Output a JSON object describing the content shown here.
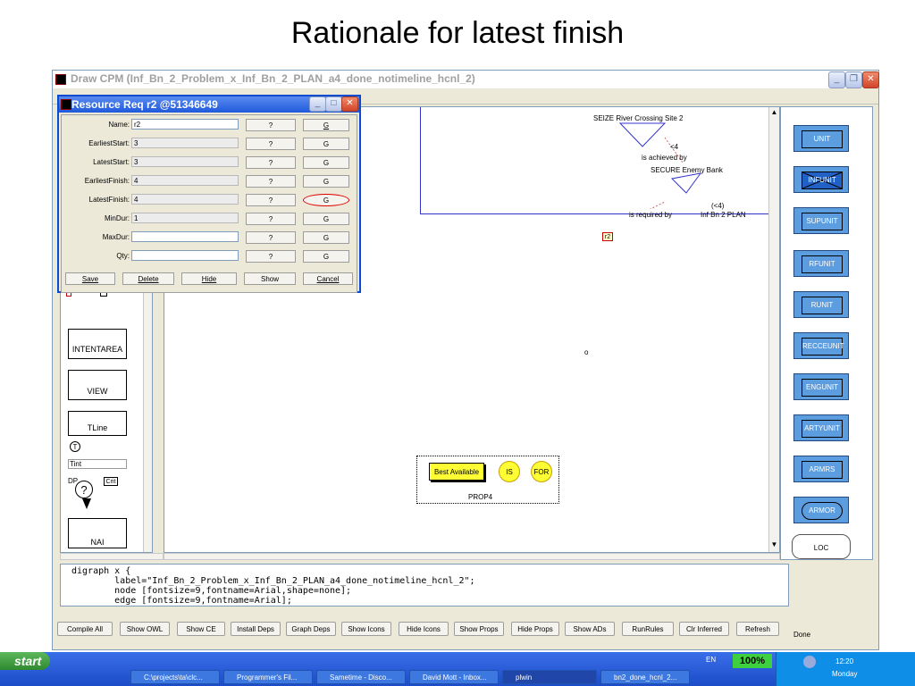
{
  "slide": {
    "title": "Rationale for latest finish"
  },
  "window": {
    "title": "Draw CPM (Inf_Bn_2_Problem_x_Inf_Bn_2_PLAN_a4_done_notimeline_hcnl_2)",
    "min": "_",
    "max": "❐",
    "close": "✕"
  },
  "dialog": {
    "title": "Resource Req r2 @51346649",
    "fields": [
      {
        "label": "Name:",
        "value": "r2",
        "q": "?",
        "g": "G"
      },
      {
        "label": "EarliestStart:",
        "value": "3",
        "q": "?",
        "g": "G"
      },
      {
        "label": "LatestStart:",
        "value": "3",
        "q": "?",
        "g": "G"
      },
      {
        "label": "EarliestFinish:",
        "value": "4",
        "q": "?",
        "g": "G"
      },
      {
        "label": "LatestFinish:",
        "value": "4",
        "q": "?",
        "g": "G"
      },
      {
        "label": "MinDur:",
        "value": "1",
        "q": "?",
        "g": "G"
      },
      {
        "label": "MaxDur:",
        "value": "",
        "q": "?",
        "g": "G"
      },
      {
        "label": "Qty:",
        "value": "",
        "q": "?",
        "g": "G"
      }
    ],
    "buttons": {
      "save": "Save",
      "delete": "Delete",
      "hide": "Hide",
      "show": "Show",
      "cancel": "Cancel"
    },
    "min": "_",
    "max": "□",
    "close": "✕"
  },
  "left_palette": {
    "intentarea": "INTENTAREA",
    "view": "VIEW",
    "tline": "TLine",
    "circle_t": "T",
    "tint": "Tint",
    "dp": "DP",
    "question": "?",
    "crit": "Crit",
    "nai": "NAI"
  },
  "graph": {
    "seize": "SEIZE River Crossing Site 2",
    "lt4": "<4",
    "achieved_by": "is achieved by",
    "secure": "SECURE Enemy Bank",
    "lt4b": "(<4)",
    "required_by": "is required by",
    "plan": "Inf Bn 2 PLAN",
    "r2": "r2",
    "dot": "o",
    "best_available": "Best Available",
    "is": "IS",
    "for": "FOR",
    "prop4": "PROP4"
  },
  "right_palette": [
    {
      "label": "UNIT",
      "icon": "unit-box-icon"
    },
    {
      "label": "INFUNIT",
      "icon": "infantry-cross-icon"
    },
    {
      "label": "SUPUNIT",
      "icon": "support-unit-icon"
    },
    {
      "label": "RFUNIT",
      "icon": "bowtie-icon"
    },
    {
      "label": "RUNIT",
      "icon": "rotary-icon"
    },
    {
      "label": "RECCEUNIT",
      "icon": "recce-slash-icon"
    },
    {
      "label": "ENGUNIT",
      "icon": "engineer-icon"
    },
    {
      "label": "ARTYUNIT",
      "icon": "artillery-dot-icon"
    },
    {
      "label": "ARMRS",
      "icon": "armored-triangle-icon"
    },
    {
      "label": "ARMOR",
      "icon": "armor-oval-icon"
    },
    {
      "label": "LOC",
      "icon": "loc-icon"
    }
  ],
  "code": {
    "lines": [
      "digraph x {",
      "        label=\"Inf_Bn_2_Problem_x_Inf_Bn_2_PLAN_a4_done_notimeline_hcnl_2\";",
      "        node [fontsize=9,fontname=Arial,shape=none];",
      "        edge [fontsize=9,fontname=Arial];"
    ]
  },
  "toolbar": {
    "buttons": [
      "Compile All",
      "Show OWL",
      "Show CE",
      "Install Deps",
      "Graph Deps",
      "Show Icons",
      "Hide Icons",
      "Show Props",
      "Hide Props",
      "Show ADs",
      "RunRules",
      "Clr Inferred",
      "Refresh"
    ],
    "status": "Done"
  },
  "taskbar": {
    "start": "start",
    "items": [
      "C:\\projects\\ta\\clc...",
      "Programmer's Fil...",
      "Sametime - Disco...",
      "David Mott - Inbox...",
      "plwin",
      "bn2_done_hcnl_2..."
    ],
    "lang": "EN",
    "zoom": "100%",
    "time": "12:20",
    "day": "Monday"
  },
  "colors": {
    "accent": "#1f5adc",
    "palette": "#5c9de0",
    "highlight": "#ffff33",
    "taskbar": "#2458d8"
  }
}
